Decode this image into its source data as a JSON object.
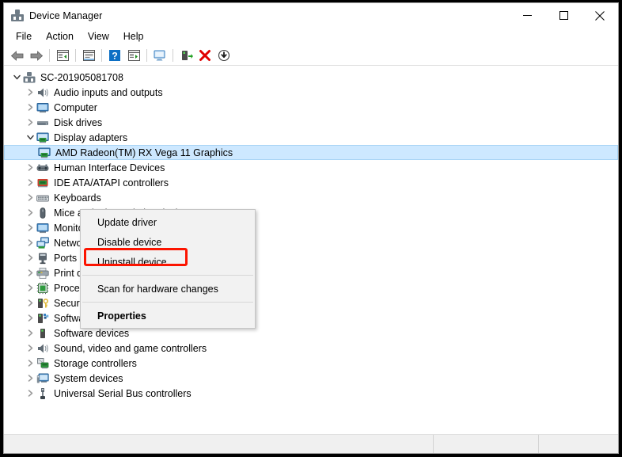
{
  "window": {
    "title": "Device Manager",
    "icon": "device-manager-icon",
    "controls": {
      "minimize": "minimize-icon",
      "maximize": "maximize-icon",
      "close": "close-icon"
    }
  },
  "menubar": {
    "items": [
      {
        "label": "File"
      },
      {
        "label": "Action"
      },
      {
        "label": "View"
      },
      {
        "label": "Help"
      }
    ]
  },
  "toolbar": {
    "buttons": [
      {
        "name": "back-arrow-icon"
      },
      {
        "name": "forward-arrow-icon"
      },
      {
        "name": "show-hide-console-tree-icon"
      },
      {
        "name": "properties-icon"
      },
      {
        "name": "help-icon"
      },
      {
        "name": "update-driver-icon"
      },
      {
        "name": "scan-for-hardware-changes-icon"
      },
      {
        "name": "update-driver-software-icon"
      },
      {
        "name": "uninstall-device-icon"
      },
      {
        "name": "disable-device-icon"
      }
    ]
  },
  "tree": {
    "root": {
      "label": "SC-201905081708",
      "icon": "computer-root-icon",
      "expanded": true
    },
    "items": [
      {
        "label": "Audio inputs and outputs",
        "icon": "speaker-icon",
        "expanded": false,
        "level": 1
      },
      {
        "label": "Computer",
        "icon": "monitor-icon",
        "expanded": false,
        "level": 1
      },
      {
        "label": "Disk drives",
        "icon": "disk-drive-icon",
        "expanded": false,
        "level": 1
      },
      {
        "label": "Display adapters",
        "icon": "display-adapter-icon",
        "expanded": true,
        "level": 1
      },
      {
        "label": "AMD Radeon(TM) RX Vega 11 Graphics",
        "icon": "display-adapter-icon",
        "level": 2,
        "selected": true
      },
      {
        "label": "Human Interface Devices",
        "icon": "hid-icon",
        "expanded": false,
        "level": 1
      },
      {
        "label": "IDE ATA/ATAPI controllers",
        "icon": "ide-controller-icon",
        "expanded": false,
        "level": 1
      },
      {
        "label": "Keyboards",
        "icon": "keyboard-icon",
        "expanded": false,
        "level": 1
      },
      {
        "label": "Mice and other pointing devices",
        "icon": "mouse-icon",
        "expanded": false,
        "level": 1
      },
      {
        "label": "Monitors",
        "icon": "monitor-icon",
        "expanded": false,
        "level": 1
      },
      {
        "label": "Network adapters",
        "icon": "network-adapter-icon",
        "expanded": false,
        "level": 1
      },
      {
        "label": "Ports (COM & LPT)",
        "icon": "port-icon",
        "expanded": false,
        "level": 1
      },
      {
        "label": "Print queues",
        "icon": "printer-icon",
        "expanded": false,
        "level": 1
      },
      {
        "label": "Processors",
        "icon": "processor-icon",
        "expanded": false,
        "level": 1
      },
      {
        "label": "Security devices",
        "icon": "security-device-icon",
        "expanded": false,
        "level": 1
      },
      {
        "label": "Software components",
        "icon": "software-component-icon",
        "expanded": false,
        "level": 1
      },
      {
        "label": "Software devices",
        "icon": "software-device-icon",
        "expanded": false,
        "level": 1
      },
      {
        "label": "Sound, video and game controllers",
        "icon": "speaker-icon",
        "expanded": false,
        "level": 1
      },
      {
        "label": "Storage controllers",
        "icon": "storage-controller-icon",
        "expanded": false,
        "level": 1
      },
      {
        "label": "System devices",
        "icon": "system-device-icon",
        "expanded": false,
        "level": 1
      },
      {
        "label": "Universal Serial Bus controllers",
        "icon": "usb-controller-icon",
        "expanded": false,
        "level": 1
      }
    ]
  },
  "context_menu": {
    "items": [
      {
        "label": "Update driver",
        "type": "item"
      },
      {
        "label": "Disable device",
        "type": "item"
      },
      {
        "label": "Uninstall device",
        "type": "item",
        "highlighted": true
      },
      {
        "type": "separator"
      },
      {
        "label": "Scan for hardware changes",
        "type": "item"
      },
      {
        "type": "separator"
      },
      {
        "label": "Properties",
        "type": "item",
        "bold": true
      }
    ]
  },
  "annotation": {
    "highlight_color": "#fc1400",
    "target": "Uninstall device"
  },
  "statusbar": {
    "panes": [
      "",
      "",
      ""
    ]
  },
  "colors": {
    "selection": "#cde8ff",
    "window_bg": "#ffffff",
    "statusbar_bg": "#f0f0f0",
    "menu_bg": "#f2f2f2",
    "annotation_red": "#fc1400"
  }
}
